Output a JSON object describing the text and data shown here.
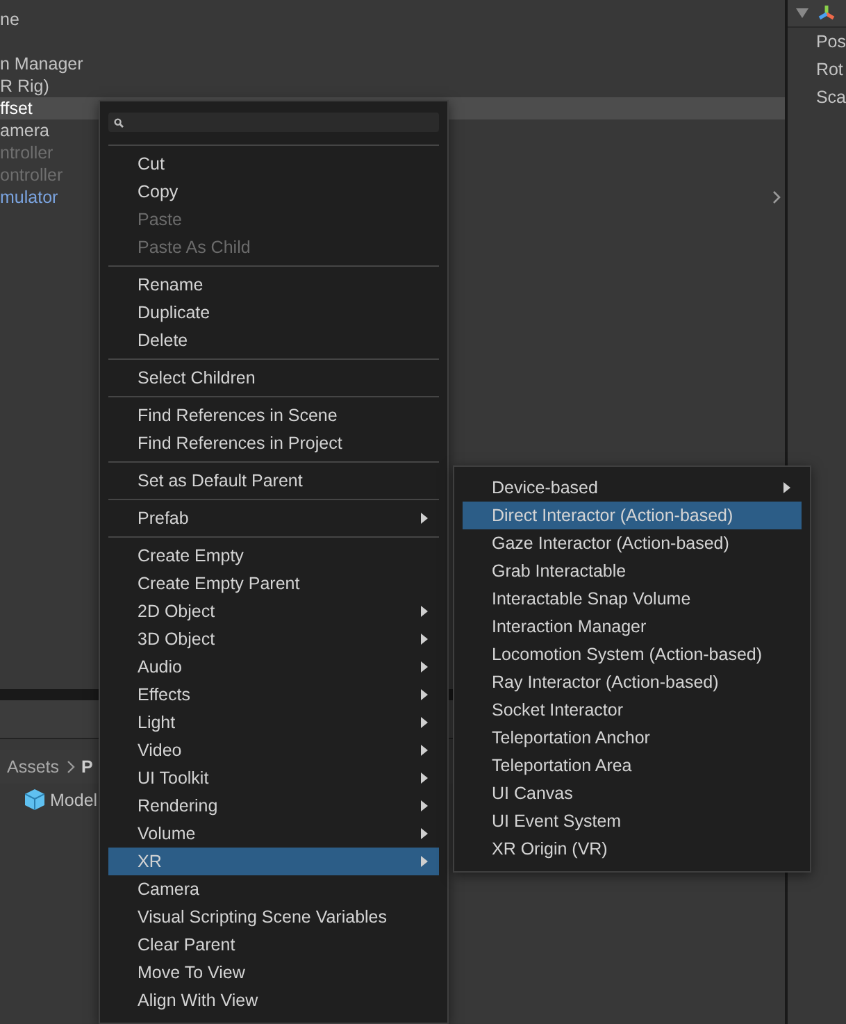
{
  "hierarchy": {
    "rows": [
      {
        "label": "ne",
        "kind": "normal",
        "selected": false
      },
      {
        "kind": "gap"
      },
      {
        "label": "n Manager",
        "kind": "normal",
        "selected": false
      },
      {
        "label": "R Rig)",
        "kind": "normal",
        "selected": false
      },
      {
        "label": "ffset",
        "kind": "normal",
        "selected": true
      },
      {
        "label": "amera",
        "kind": "normal",
        "selected": false
      },
      {
        "label": "ntroller",
        "kind": "inactive",
        "selected": false
      },
      {
        "label": "ontroller",
        "kind": "inactive",
        "selected": false
      },
      {
        "label": "mulator",
        "kind": "prefab",
        "selected": false,
        "expandable": true
      }
    ]
  },
  "inspector": {
    "rows": [
      "Pos",
      "Rot",
      "Sca"
    ]
  },
  "project": {
    "breadcrumb": [
      "Assets",
      "P"
    ],
    "items": [
      {
        "label": "Model"
      }
    ]
  },
  "context_menu": {
    "items": [
      {
        "kind": "item",
        "label": "Cut",
        "disabled": false,
        "submenu": false,
        "selected": false
      },
      {
        "kind": "item",
        "label": "Copy",
        "disabled": false,
        "submenu": false,
        "selected": false
      },
      {
        "kind": "item",
        "label": "Paste",
        "disabled": true,
        "submenu": false,
        "selected": false
      },
      {
        "kind": "item",
        "label": "Paste As Child",
        "disabled": true,
        "submenu": false,
        "selected": false
      },
      {
        "kind": "separator"
      },
      {
        "kind": "item",
        "label": "Rename",
        "disabled": false,
        "submenu": false,
        "selected": false
      },
      {
        "kind": "item",
        "label": "Duplicate",
        "disabled": false,
        "submenu": false,
        "selected": false
      },
      {
        "kind": "item",
        "label": "Delete",
        "disabled": false,
        "submenu": false,
        "selected": false
      },
      {
        "kind": "separator"
      },
      {
        "kind": "item",
        "label": "Select Children",
        "disabled": false,
        "submenu": false,
        "selected": false
      },
      {
        "kind": "separator"
      },
      {
        "kind": "item",
        "label": "Find References in Scene",
        "disabled": false,
        "submenu": false,
        "selected": false
      },
      {
        "kind": "item",
        "label": "Find References in Project",
        "disabled": false,
        "submenu": false,
        "selected": false
      },
      {
        "kind": "separator"
      },
      {
        "kind": "item",
        "label": "Set as Default Parent",
        "disabled": false,
        "submenu": false,
        "selected": false
      },
      {
        "kind": "separator"
      },
      {
        "kind": "item",
        "label": "Prefab",
        "disabled": false,
        "submenu": true,
        "selected": false
      },
      {
        "kind": "separator"
      },
      {
        "kind": "item",
        "label": "Create Empty",
        "disabled": false,
        "submenu": false,
        "selected": false
      },
      {
        "kind": "item",
        "label": "Create Empty Parent",
        "disabled": false,
        "submenu": false,
        "selected": false
      },
      {
        "kind": "item",
        "label": "2D Object",
        "disabled": false,
        "submenu": true,
        "selected": false
      },
      {
        "kind": "item",
        "label": "3D Object",
        "disabled": false,
        "submenu": true,
        "selected": false
      },
      {
        "kind": "item",
        "label": "Audio",
        "disabled": false,
        "submenu": true,
        "selected": false
      },
      {
        "kind": "item",
        "label": "Effects",
        "disabled": false,
        "submenu": true,
        "selected": false
      },
      {
        "kind": "item",
        "label": "Light",
        "disabled": false,
        "submenu": true,
        "selected": false
      },
      {
        "kind": "item",
        "label": "Video",
        "disabled": false,
        "submenu": true,
        "selected": false
      },
      {
        "kind": "item",
        "label": "UI Toolkit",
        "disabled": false,
        "submenu": true,
        "selected": false
      },
      {
        "kind": "item",
        "label": "Rendering",
        "disabled": false,
        "submenu": true,
        "selected": false
      },
      {
        "kind": "item",
        "label": "Volume",
        "disabled": false,
        "submenu": true,
        "selected": false
      },
      {
        "kind": "item",
        "label": "XR",
        "disabled": false,
        "submenu": true,
        "selected": true
      },
      {
        "kind": "item",
        "label": "Camera",
        "disabled": false,
        "submenu": false,
        "selected": false
      },
      {
        "kind": "item",
        "label": "Visual Scripting Scene Variables",
        "disabled": false,
        "submenu": false,
        "selected": false
      },
      {
        "kind": "item",
        "label": "Clear Parent",
        "disabled": false,
        "submenu": false,
        "selected": false
      },
      {
        "kind": "item",
        "label": "Move To View",
        "disabled": false,
        "submenu": false,
        "selected": false
      },
      {
        "kind": "item",
        "label": "Align With View",
        "disabled": false,
        "submenu": false,
        "selected": false
      }
    ]
  },
  "submenu": {
    "items": [
      {
        "kind": "item",
        "label": "Device-based",
        "disabled": false,
        "submenu": true,
        "selected": false
      },
      {
        "kind": "item",
        "label": "Direct Interactor (Action-based)",
        "disabled": false,
        "submenu": false,
        "selected": true
      },
      {
        "kind": "item",
        "label": "Gaze Interactor (Action-based)",
        "disabled": false,
        "submenu": false,
        "selected": false
      },
      {
        "kind": "item",
        "label": "Grab Interactable",
        "disabled": false,
        "submenu": false,
        "selected": false
      },
      {
        "kind": "item",
        "label": "Interactable Snap Volume",
        "disabled": false,
        "submenu": false,
        "selected": false
      },
      {
        "kind": "item",
        "label": "Interaction Manager",
        "disabled": false,
        "submenu": false,
        "selected": false
      },
      {
        "kind": "item",
        "label": "Locomotion System (Action-based)",
        "disabled": false,
        "submenu": false,
        "selected": false
      },
      {
        "kind": "item",
        "label": "Ray Interactor (Action-based)",
        "disabled": false,
        "submenu": false,
        "selected": false
      },
      {
        "kind": "item",
        "label": "Socket Interactor",
        "disabled": false,
        "submenu": false,
        "selected": false
      },
      {
        "kind": "item",
        "label": "Teleportation Anchor",
        "disabled": false,
        "submenu": false,
        "selected": false
      },
      {
        "kind": "item",
        "label": "Teleportation Area",
        "disabled": false,
        "submenu": false,
        "selected": false
      },
      {
        "kind": "item",
        "label": "UI Canvas",
        "disabled": false,
        "submenu": false,
        "selected": false
      },
      {
        "kind": "item",
        "label": "UI Event System",
        "disabled": false,
        "submenu": false,
        "selected": false
      },
      {
        "kind": "item",
        "label": "XR Origin (VR)",
        "disabled": false,
        "submenu": false,
        "selected": false
      }
    ]
  }
}
